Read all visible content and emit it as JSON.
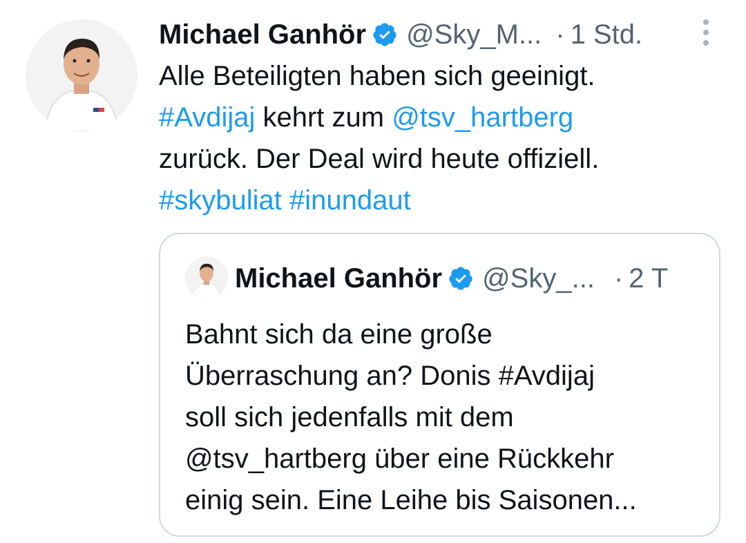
{
  "tweet": {
    "author_name": "Michael Ganhör",
    "author_handle": "@Sky_M...",
    "separator": "·",
    "time": "1 Std.",
    "verified_icon": "verified-badge-icon",
    "more_icon": "more-options-icon",
    "lines": [
      [
        {
          "text": "Alle Beteiligten haben sich geeinigt.",
          "link": false
        }
      ],
      [
        {
          "text": "#Avdijaj",
          "link": true
        },
        {
          "text": " kehrt zum ",
          "link": false
        },
        {
          "text": "@tsv_hartberg",
          "link": true
        }
      ],
      [
        {
          "text": "zurück. Der Deal wird heute offiziell.",
          "link": false
        }
      ],
      [
        {
          "text": "#skybuliat",
          "link": true
        },
        {
          "text": " ",
          "link": false
        },
        {
          "text": "#inundaut",
          "link": true
        }
      ]
    ]
  },
  "quoted_tweet": {
    "author_name": "Michael Ganhör",
    "author_handle": "@Sky_...",
    "separator": "·",
    "time": "2 T",
    "lines": [
      "Bahnt sich da eine große",
      "Überraschung an? Donis #Avdijaj",
      "soll sich jedenfalls mit dem",
      "@tsv_hartberg über eine Rückkehr",
      "einig sein. Eine Leihe bis Saisonen..."
    ]
  },
  "colors": {
    "link": "#1d9bf0",
    "text": "#0f1419",
    "secondary": "#536471",
    "verified": "#1d9bf0",
    "border": "#cfd9de"
  }
}
